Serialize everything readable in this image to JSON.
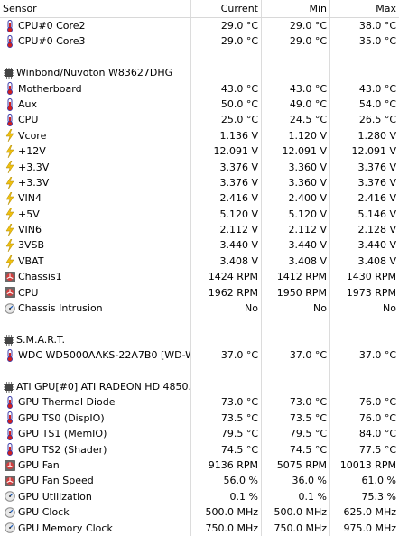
{
  "header": {
    "sensor": "Sensor",
    "current": "Current",
    "min": "Min",
    "max": "Max"
  },
  "rows": [
    {
      "type": "item",
      "icon": "thermometer-icon",
      "name": "CPU#0 Core2",
      "cur": "29.0 °C",
      "min": "29.0 °C",
      "max": "38.0 °C"
    },
    {
      "type": "item",
      "icon": "thermometer-icon",
      "name": "CPU#0 Core3",
      "cur": "29.0 °C",
      "min": "29.0 °C",
      "max": "35.0 °C"
    },
    {
      "type": "blank"
    },
    {
      "type": "group",
      "icon": "chip-icon",
      "name": "Winbond/Nuvoton W83627DHG"
    },
    {
      "type": "item",
      "icon": "thermometer-icon",
      "name": "Motherboard",
      "cur": "43.0 °C",
      "min": "43.0 °C",
      "max": "43.0 °C"
    },
    {
      "type": "item",
      "icon": "thermometer-icon",
      "name": "Aux",
      "cur": "50.0 °C",
      "min": "49.0 °C",
      "max": "54.0 °C"
    },
    {
      "type": "item",
      "icon": "thermometer-icon",
      "name": "CPU",
      "cur": "25.0 °C",
      "min": "24.5 °C",
      "max": "26.5 °C"
    },
    {
      "type": "item",
      "icon": "voltage-icon",
      "name": "Vcore",
      "cur": "1.136 V",
      "min": "1.120 V",
      "max": "1.280 V"
    },
    {
      "type": "item",
      "icon": "voltage-icon",
      "name": "+12V",
      "cur": "12.091 V",
      "min": "12.091 V",
      "max": "12.091 V"
    },
    {
      "type": "item",
      "icon": "voltage-icon",
      "name": "+3.3V",
      "cur": "3.376 V",
      "min": "3.360 V",
      "max": "3.376 V"
    },
    {
      "type": "item",
      "icon": "voltage-icon",
      "name": "+3.3V",
      "cur": "3.376 V",
      "min": "3.360 V",
      "max": "3.376 V"
    },
    {
      "type": "item",
      "icon": "voltage-icon",
      "name": "VIN4",
      "cur": "2.416 V",
      "min": "2.400 V",
      "max": "2.416 V"
    },
    {
      "type": "item",
      "icon": "voltage-icon",
      "name": "+5V",
      "cur": "5.120 V",
      "min": "5.120 V",
      "max": "5.146 V"
    },
    {
      "type": "item",
      "icon": "voltage-icon",
      "name": "VIN6",
      "cur": "2.112 V",
      "min": "2.112 V",
      "max": "2.128 V"
    },
    {
      "type": "item",
      "icon": "voltage-icon",
      "name": "3VSB",
      "cur": "3.440 V",
      "min": "3.440 V",
      "max": "3.440 V"
    },
    {
      "type": "item",
      "icon": "voltage-icon",
      "name": "VBAT",
      "cur": "3.408 V",
      "min": "3.408 V",
      "max": "3.408 V"
    },
    {
      "type": "item",
      "icon": "fan-icon",
      "name": "Chassis1",
      "cur": "1424 RPM",
      "min": "1412 RPM",
      "max": "1430 RPM"
    },
    {
      "type": "item",
      "icon": "fan-icon",
      "name": "CPU",
      "cur": "1962 RPM",
      "min": "1950 RPM",
      "max": "1973 RPM"
    },
    {
      "type": "item",
      "icon": "gauge-icon",
      "name": "Chassis Intrusion",
      "cur": "No",
      "min": "No",
      "max": "No"
    },
    {
      "type": "blank"
    },
    {
      "type": "group",
      "icon": "chip-icon",
      "name": "S.M.A.R.T."
    },
    {
      "type": "item",
      "icon": "thermometer-icon",
      "name": "WDC WD5000AAKS-22A7B0 [WD-W...",
      "cur": "37.0 °C",
      "min": "37.0 °C",
      "max": "37.0 °C"
    },
    {
      "type": "blank"
    },
    {
      "type": "group",
      "icon": "chip-icon",
      "name": "ATI GPU[#0] ATI RADEON HD 4850..."
    },
    {
      "type": "item",
      "icon": "thermometer-icon",
      "name": "GPU Thermal Diode",
      "cur": "73.0 °C",
      "min": "73.0 °C",
      "max": "76.0 °C"
    },
    {
      "type": "item",
      "icon": "thermometer-icon",
      "name": "GPU TS0 (DispIO)",
      "cur": "73.5 °C",
      "min": "73.5 °C",
      "max": "76.0 °C"
    },
    {
      "type": "item",
      "icon": "thermometer-icon",
      "name": "GPU TS1 (MemIO)",
      "cur": "79.5 °C",
      "min": "79.5 °C",
      "max": "84.0 °C"
    },
    {
      "type": "item",
      "icon": "thermometer-icon",
      "name": "GPU TS2 (Shader)",
      "cur": "74.5 °C",
      "min": "74.5 °C",
      "max": "77.5 °C"
    },
    {
      "type": "item",
      "icon": "fan-icon",
      "name": "GPU Fan",
      "cur": "9136 RPM",
      "min": "5075 RPM",
      "max": "10013 RPM"
    },
    {
      "type": "item",
      "icon": "fan-icon",
      "name": "GPU Fan Speed",
      "cur": "56.0 %",
      "min": "36.0 %",
      "max": "61.0 %"
    },
    {
      "type": "item",
      "icon": "gauge-icon",
      "name": "GPU Utilization",
      "cur": "0.1 %",
      "min": "0.1 %",
      "max": "75.3 %"
    },
    {
      "type": "item",
      "icon": "gauge-icon",
      "name": "GPU Clock",
      "cur": "500.0 MHz",
      "min": "500.0 MHz",
      "max": "625.0 MHz"
    },
    {
      "type": "item",
      "icon": "gauge-icon",
      "name": "GPU Memory Clock",
      "cur": "750.0 MHz",
      "min": "750.0 MHz",
      "max": "975.0 MHz"
    }
  ],
  "colors": {
    "thermometer": "#3a3aa8",
    "thermometer_bulb": "#d02020",
    "voltage": "#f0c010",
    "fan_bg": "#6a6a6a",
    "chip": "#444444",
    "gauge": "#8a8a8a"
  }
}
